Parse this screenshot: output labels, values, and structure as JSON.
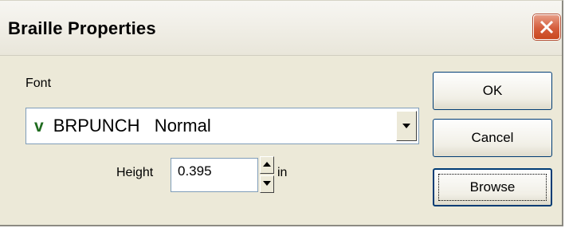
{
  "window": {
    "title": "Braille Properties"
  },
  "icons": {
    "close": "close-icon",
    "check": "green-check",
    "dropdown": "chevron-down-icon",
    "spin_up": "triangle-up-icon",
    "spin_down": "triangle-down-icon"
  },
  "font": {
    "label": "Font",
    "check_glyph": "v",
    "selected_value": "BRPUNCH   Normal"
  },
  "height": {
    "label": "Height",
    "value": "0.395",
    "unit": "in"
  },
  "buttons": {
    "ok": "OK",
    "cancel": "Cancel",
    "browse": "Browse"
  },
  "colors": {
    "close_button": "#d55d3c",
    "check": "#1f6b1f",
    "dialog_bg": "#ece9d8"
  }
}
